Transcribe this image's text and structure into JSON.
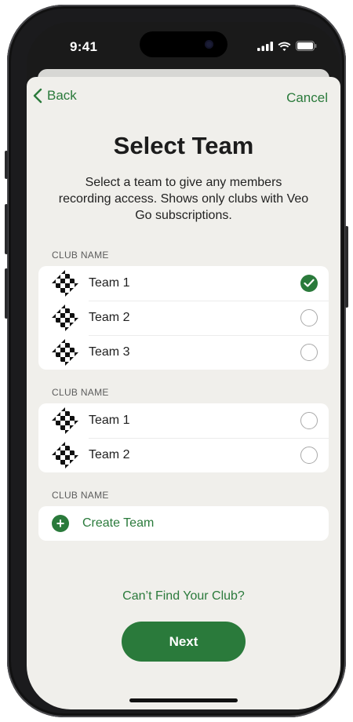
{
  "status": {
    "time": "9:41"
  },
  "nav": {
    "back_label": "Back",
    "cancel_label": "Cancel"
  },
  "header": {
    "title": "Select Team",
    "subtitle": "Select a team to give any members recording access. Shows only clubs with Veo Go subscriptions."
  },
  "clubs": [
    {
      "label": "CLUB NAME",
      "teams": [
        {
          "name": "Team 1",
          "selected": true
        },
        {
          "name": "Team 2",
          "selected": false
        },
        {
          "name": "Team 3",
          "selected": false
        }
      ]
    },
    {
      "label": "CLUB NAME",
      "teams": [
        {
          "name": "Team 1",
          "selected": false
        },
        {
          "name": "Team 2",
          "selected": false
        }
      ]
    },
    {
      "label": "CLUB NAME",
      "create_label": "Create Team"
    }
  ],
  "footer": {
    "cant_find_label": "Can’t Find Your Club?",
    "next_label": "Next"
  },
  "colors": {
    "accent": "#2a7a3b",
    "sheet_bg": "#f0efeb"
  }
}
